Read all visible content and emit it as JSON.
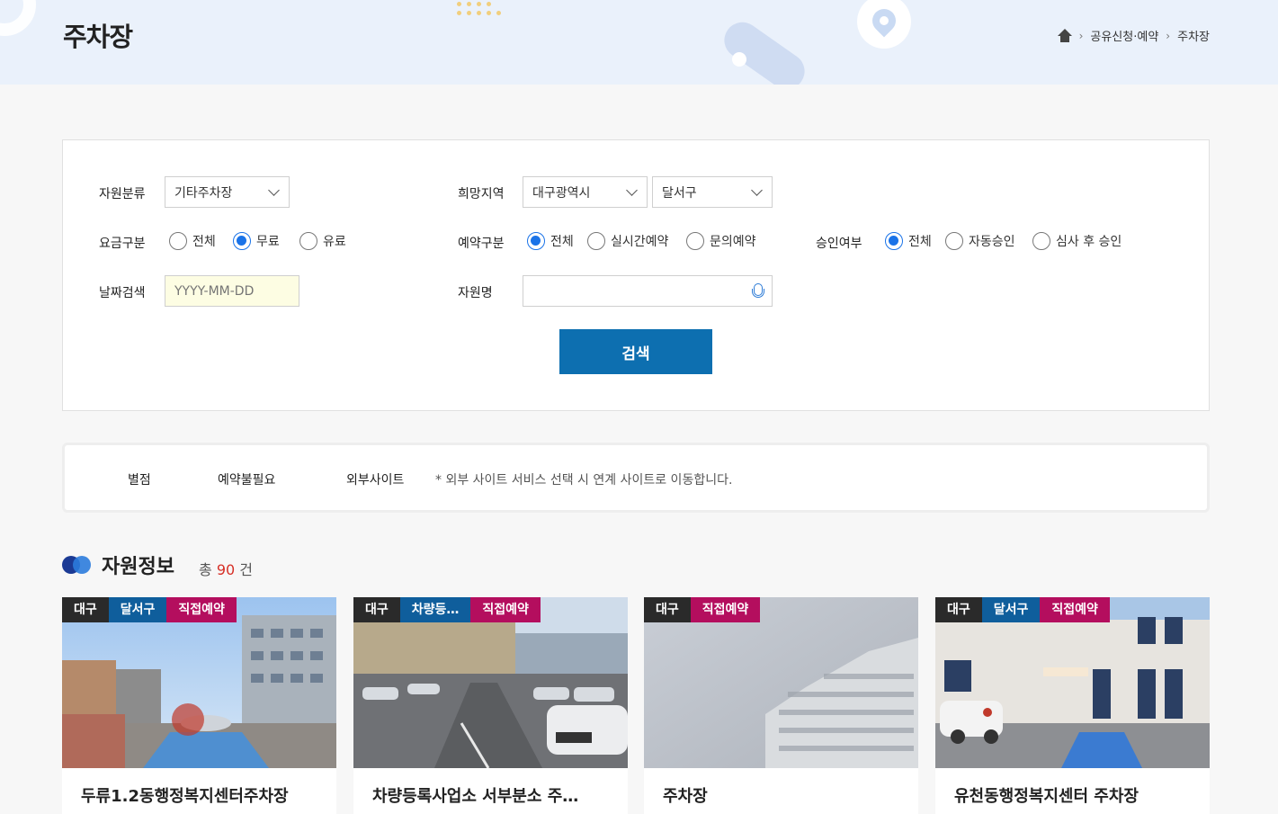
{
  "page": {
    "title": "주차장"
  },
  "breadcrumb": {
    "items": [
      "공유신청·예약",
      "주차장"
    ]
  },
  "search": {
    "resource_type": {
      "label": "자원분류",
      "value": "기타주차장"
    },
    "region": {
      "label": "희망지역",
      "city": "대구광역시",
      "district": "달서구"
    },
    "fee": {
      "label": "요금구분",
      "options": [
        "전체",
        "무료",
        "유료"
      ],
      "selected": "무료"
    },
    "reservation": {
      "label": "예약구분",
      "options": [
        "전체",
        "실시간예약",
        "문의예약"
      ],
      "selected": "전체"
    },
    "approval": {
      "label": "승인여부",
      "options": [
        "전체",
        "자동승인",
        "심사 후 승인"
      ],
      "selected": "전체"
    },
    "date": {
      "label": "날짜검색",
      "placeholder": "YYYY-MM-DD"
    },
    "name": {
      "label": "자원명",
      "placeholder": ""
    },
    "button_label": "검색"
  },
  "legend": {
    "items": [
      "별점",
      "예약불필요",
      "외부사이트"
    ],
    "note": "* 외부 사이트 서비스 선택 시 연계 사이트로 이동합니다."
  },
  "results": {
    "title": "자원정보",
    "count_prefix": "총",
    "count": "90",
    "count_suffix": "건",
    "cards": [
      {
        "tags": [
          "대구",
          "달서구",
          "직접예약"
        ],
        "title": "두류1.2동행정복지센터주차장"
      },
      {
        "tags": [
          "대구",
          "차량등…",
          "직접예약"
        ],
        "title": "차량등록사업소 서부분소 주…"
      },
      {
        "tags": [
          "대구",
          "직접예약"
        ],
        "title": "주차장"
      },
      {
        "tags": [
          "대구",
          "달서구",
          "직접예약"
        ],
        "title": "유천동행정복지센터 주차장"
      }
    ]
  },
  "colors": {
    "primary_button": "#0d6fb0",
    "tag_region": "#2a2a2a",
    "tag_district": "#0f5e9c",
    "tag_direct": "#b40e5e",
    "count_highlight": "#d63027",
    "radio_selected": "#1a73e8"
  }
}
